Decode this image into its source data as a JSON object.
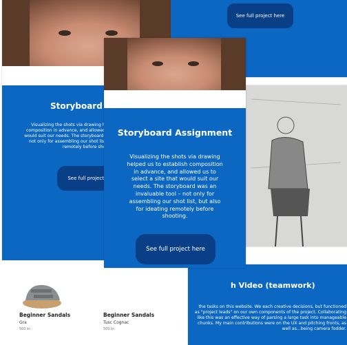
{
  "cards": {
    "top_right_button": "See full project here",
    "left": {
      "title": "Storyboard Assi",
      "body": "Visualizing the shots via drawing helped us to establish composition in advance, and allowed us to select a site that would suit our needs. The storyboard was an invaluable tool – not only for assembling our shot list, but also for ideating remotely before shooting.",
      "button": "See full project h"
    },
    "center": {
      "title": "Storyboard Assignment",
      "body": "Visualizing the shots via drawing helped us to establish composition in advance, and allowed us to select a site that would suit our needs. The storyboard was an invaluable tool – not only for assembling our shot list, but also for ideating remotely before shooting.",
      "button": "See full project here"
    },
    "bottom_right": {
      "title": "h Video (teamwork)",
      "body": "the tasks on this website. We each creative decisions, but functioned as \"project leads\" on our own components of the project. Collaborating like this was an effective way of parsing a large task into manageable chunks. My main contributions were on the UX and pitching fronts, as well as...being camera fodder."
    }
  },
  "shop": {
    "product1": {
      "name": "Beginner Sandals",
      "color": "Gra",
      "price": "500 kr."
    },
    "product2": {
      "name": "Beginner Sandals",
      "color": "Tusc Cognac",
      "price": "500 kr."
    }
  }
}
